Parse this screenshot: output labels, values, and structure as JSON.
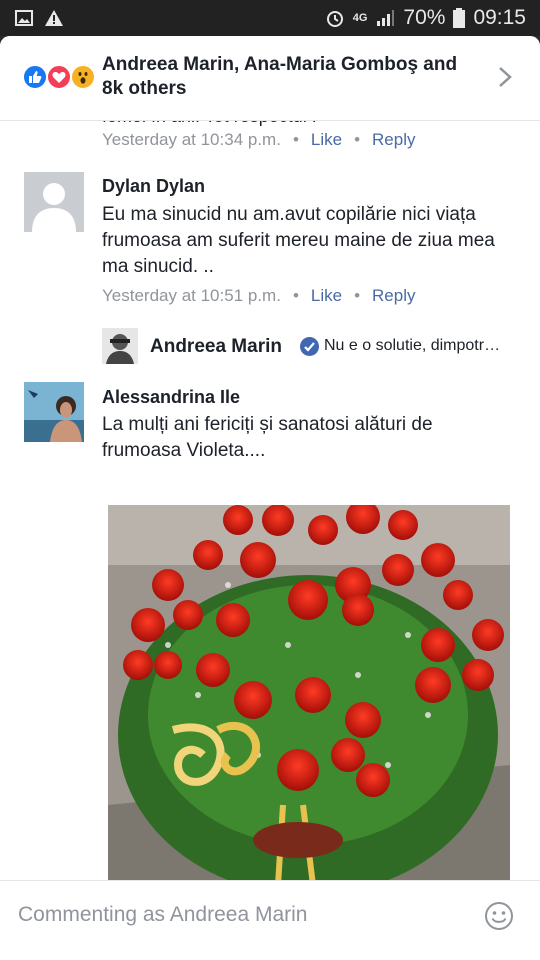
{
  "status_bar": {
    "battery": "70%",
    "time": "09:15",
    "network": "4G"
  },
  "header": {
    "title": "Andreea Marin, Ana-Maria Gomboş and 8k others",
    "reactions": [
      "like-icon",
      "love-icon",
      "wow-icon"
    ]
  },
  "comments": [
    {
      "cut_text": "femei în ani. Tot respectul !",
      "timestamp": "Yesterday at 10:34 p.m.",
      "like_label": "Like",
      "reply_label": "Reply"
    },
    {
      "name": "Dylan Dylan",
      "text": "Eu ma sinucid nu am.avut copilărie nici viața frumoasa am suferit mereu maine de ziua mea ma sinucid. ..",
      "timestamp": "Yesterday at 10:51 p.m.",
      "like_label": "Like",
      "reply_label": "Reply",
      "reply": {
        "name": "Andreea Marin",
        "text": "Nu e o solutie, dimpotr…"
      }
    },
    {
      "name": "Alessandrina Ile",
      "text": "La mulți ani fericiți și sanatosi alături de frumoasa Violeta...."
    }
  ],
  "footer": {
    "placeholder": "Commenting as Andreea Marin"
  },
  "colors": {
    "accent": "#4b6aa5",
    "muted": "#90949c",
    "like": "#1877f2",
    "love": "#f33e58",
    "wow": "#f7b125"
  }
}
